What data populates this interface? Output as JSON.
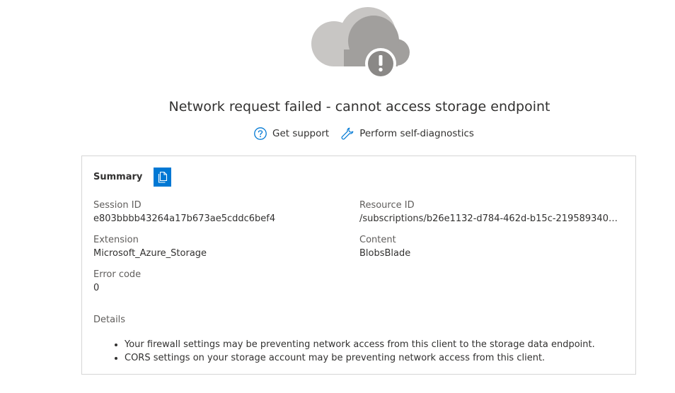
{
  "error": {
    "title": "Network request failed - cannot access storage endpoint"
  },
  "links": {
    "get_support": "Get support",
    "self_diagnostics": "Perform self-diagnostics"
  },
  "summary": {
    "label": "Summary",
    "session_id_label": "Session ID",
    "session_id": "e803bbbb43264a17b673ae5cddc6bef4",
    "resource_id_label": "Resource ID",
    "resource_id": "/subscriptions/b26e1132-d784-462d-b15c-219589340e...",
    "extension_label": "Extension",
    "extension": "Microsoft_Azure_Storage",
    "content_label": "Content",
    "content": "BlobsBlade",
    "error_code_label": "Error code",
    "error_code": "0",
    "details_label": "Details",
    "details": [
      "Your firewall settings may be preventing network access from this client to the storage data endpoint.",
      "CORS settings on your storage account may be preventing network access from this client."
    ]
  },
  "icons": {
    "illustration": "cloud-warning-icon",
    "support": "help-circle-icon",
    "diagnostics": "wrench-icon",
    "copy": "copy-icon"
  },
  "colors": {
    "accent": "#0078d4",
    "cloud_light": "#c8c6c4",
    "cloud_dark": "#a19f9d",
    "warning_badge": "#8a8886"
  }
}
